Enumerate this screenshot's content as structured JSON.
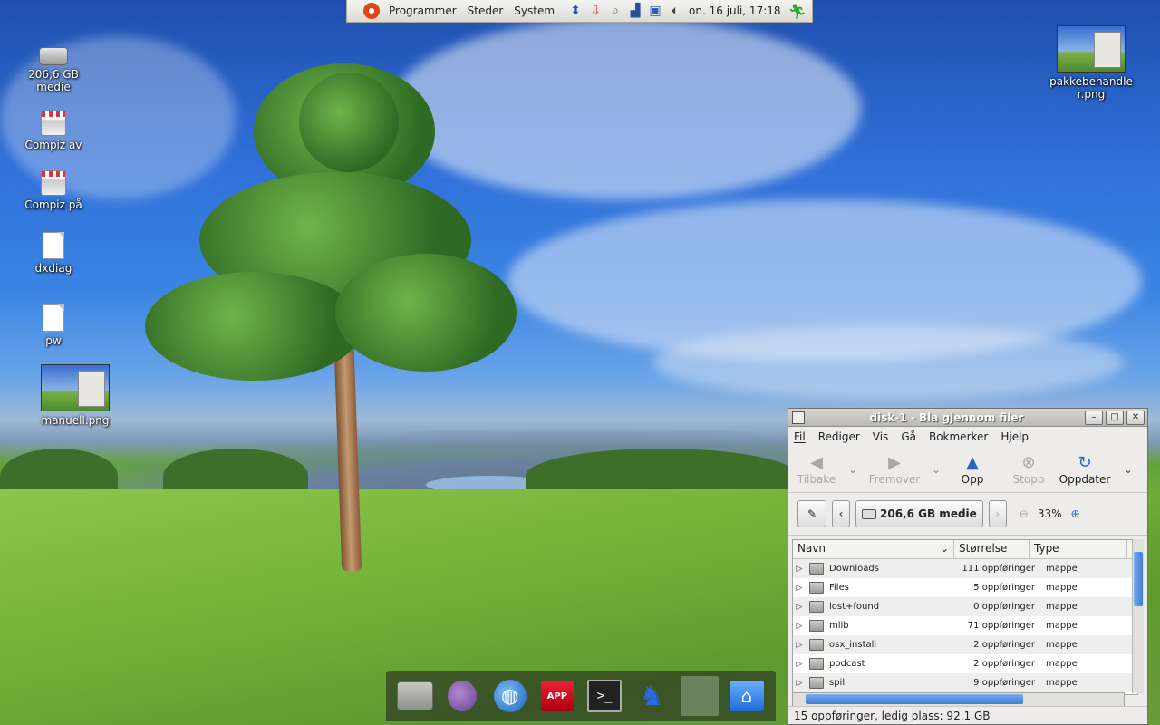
{
  "top_panel": {
    "menus": [
      "Programmer",
      "Steder",
      "System"
    ],
    "tray_icons": [
      "network-icon",
      "update-notifier-icon",
      "search-icon",
      "signal-icon",
      "workspace-icon",
      "volume-icon"
    ],
    "clock": "on. 16 juli, 17:18"
  },
  "desktop": {
    "icons": [
      {
        "label": "206,6 GB\nmedie",
        "icon": "hard-drive-icon"
      },
      {
        "label": "Compiz av",
        "icon": "compiz-off-icon"
      },
      {
        "label": "Compiz på",
        "icon": "compiz-on-icon"
      },
      {
        "label": "dxdiag",
        "icon": "text-file-icon"
      },
      {
        "label": "pw",
        "icon": "text-file-icon"
      },
      {
        "label": "manuell.png",
        "icon": "image-thumbnail-icon"
      },
      {
        "label": "pakkebehandler.png",
        "icon": "image-thumbnail-icon"
      }
    ]
  },
  "dock": {
    "items": [
      "file-manager-icon",
      "pidgin-icon",
      "browser-globe-icon",
      "app-install-icon",
      "terminal-icon",
      "frog-icon",
      "map-icon",
      "home-folder-icon"
    ],
    "app_label": "APP",
    "terminal_label": ">_"
  },
  "window": {
    "title": "disk-1 - Bla gjennom filer",
    "menu": [
      "Fil",
      "Rediger",
      "Vis",
      "Gå",
      "Bokmerker",
      "Hjelp"
    ],
    "toolbar": {
      "back": "Tilbake",
      "forward": "Fremover",
      "up": "Opp",
      "stop": "Stopp",
      "reload": "Oppdater"
    },
    "location": {
      "crumb": "206,6 GB medie",
      "zoom": "33%"
    },
    "columns": {
      "name": "Navn",
      "size": "Størrelse",
      "type": "Type"
    },
    "rows": [
      {
        "name": "Downloads",
        "size": "111 oppføringer",
        "type": "mappe"
      },
      {
        "name": "Files",
        "size": "5 oppføringer",
        "type": "mappe"
      },
      {
        "name": "lost+found",
        "size": "0 oppføringer",
        "type": "mappe"
      },
      {
        "name": "mlib",
        "size": "71 oppføringer",
        "type": "mappe"
      },
      {
        "name": "osx_install",
        "size": "2 oppføringer",
        "type": "mappe"
      },
      {
        "name": "podcast",
        "size": "2 oppføringer",
        "type": "mappe"
      },
      {
        "name": "spill",
        "size": "9 oppføringer",
        "type": "mappe"
      }
    ],
    "status": "15 oppføringer, ledig plass: 92,1 GB"
  }
}
